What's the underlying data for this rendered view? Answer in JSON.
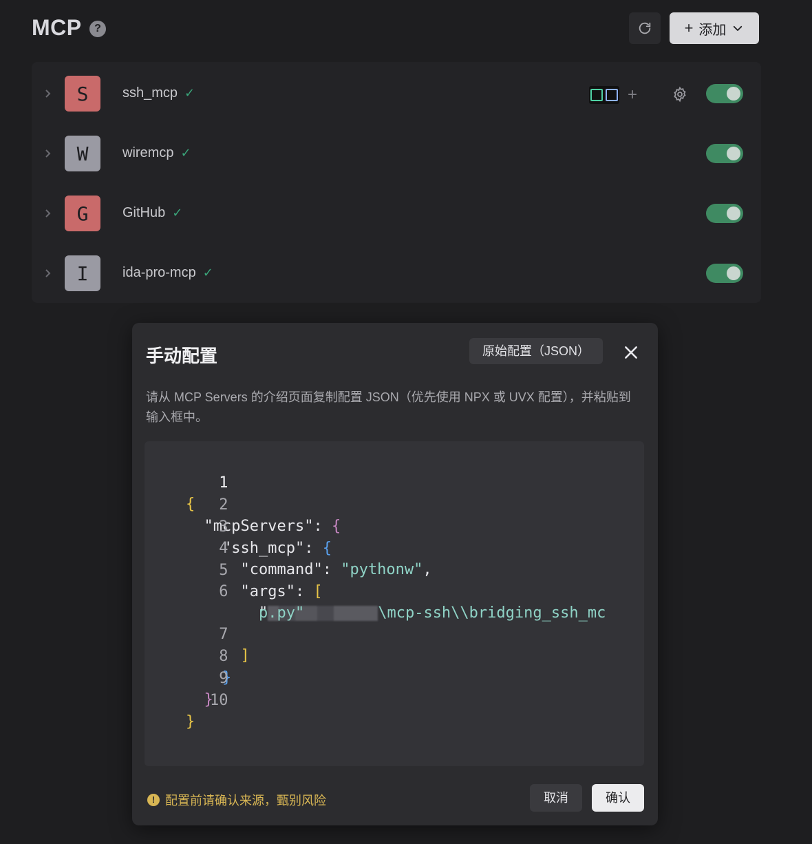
{
  "header": {
    "title": "MCP",
    "help_label": "?",
    "add_label": "添加"
  },
  "servers": [
    {
      "initial": "S",
      "name": "ssh_mcp",
      "color": "#c96a6a",
      "enabled": true
    },
    {
      "initial": "W",
      "name": "wiremcp",
      "color": "#9a9aa3",
      "enabled": true
    },
    {
      "initial": "G",
      "name": "GitHub",
      "color": "#c96a6a",
      "enabled": true
    },
    {
      "initial": "I",
      "name": "ida-pro-mcp",
      "color": "#9a9aa3",
      "enabled": true
    }
  ],
  "modal": {
    "title": "手动配置",
    "raw_button": "原始配置（JSON）",
    "description": "请从 MCP Servers 的介绍页面复制配置 JSON（优先使用 NPX 或 UVX 配置），并粘贴到输入框中。",
    "code": {
      "line_numbers": [
        "1",
        "2",
        "3",
        "4",
        "5",
        "6",
        "7",
        "8",
        "9",
        "10"
      ],
      "key_mcpServers": "\"mcpServers\"",
      "key_ssh_mcp": "\"ssh_mcp\"",
      "key_command": "\"command\"",
      "val_command": "\"pythonw\"",
      "key_args": "\"args\"",
      "arg_prefix": "\"",
      "arg_rest_1": "\\mcp-ssh\\\\bridging_ssh_mc",
      "arg_rest_2": "p.py\""
    },
    "warning": "配置前请确认来源，甄别风险",
    "cancel_label": "取消",
    "confirm_label": "确认"
  }
}
